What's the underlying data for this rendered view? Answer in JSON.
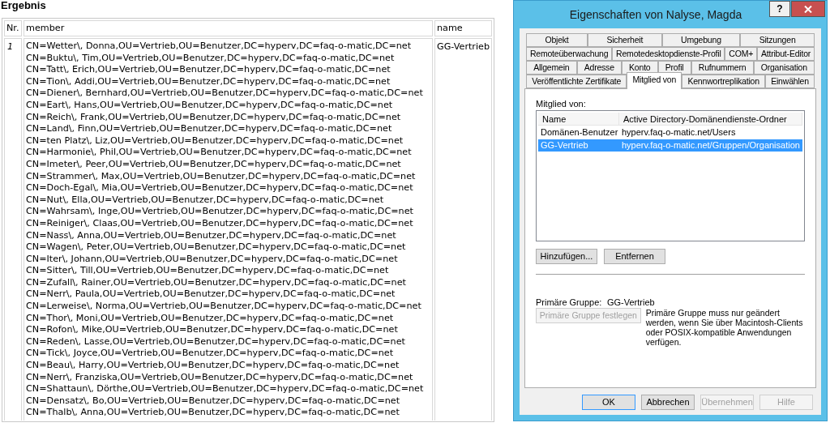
{
  "heading": "Ergebnis",
  "table": {
    "columns": [
      "Nr.",
      "member",
      "name"
    ],
    "rows": [
      {
        "nr": "1",
        "name": "GG-Vertrieb",
        "member": [
          "CN=Wetter\\, Donna,OU=Vertrieb,OU=Benutzer,DC=hyperv,DC=faq-o-matic,DC=net",
          "CN=Buktu\\, Tim,OU=Vertrieb,OU=Benutzer,DC=hyperv,DC=faq-o-matic,DC=net",
          "CN=Tatt\\, Erich,OU=Vertrieb,OU=Benutzer,DC=hyperv,DC=faq-o-matic,DC=net",
          "CN=Tion\\, Addi,OU=Vertrieb,OU=Benutzer,DC=hyperv,DC=faq-o-matic,DC=net",
          "CN=Diener\\, Bernhard,OU=Vertrieb,OU=Benutzer,DC=hyperv,DC=faq-o-matic,DC=net",
          "CN=Eart\\, Hans,OU=Vertrieb,OU=Benutzer,DC=hyperv,DC=faq-o-matic,DC=net",
          "CN=Reich\\, Frank,OU=Vertrieb,OU=Benutzer,DC=hyperv,DC=faq-o-matic,DC=net",
          "CN=Land\\, Finn,OU=Vertrieb,OU=Benutzer,DC=hyperv,DC=faq-o-matic,DC=net",
          "CN=ten Platz\\, Liz,OU=Vertrieb,OU=Benutzer,DC=hyperv,DC=faq-o-matic,DC=net",
          "CN=Harmonie\\, Phil,OU=Vertrieb,OU=Benutzer,DC=hyperv,DC=faq-o-matic,DC=net",
          "CN=Imeter\\, Peer,OU=Vertrieb,OU=Benutzer,DC=hyperv,DC=faq-o-matic,DC=net",
          "CN=Strammer\\, Max,OU=Vertrieb,OU=Benutzer,DC=hyperv,DC=faq-o-matic,DC=net",
          "CN=Doch-Egal\\, Mia,OU=Vertrieb,OU=Benutzer,DC=hyperv,DC=faq-o-matic,DC=net",
          "CN=Nut\\, Ella,OU=Vertrieb,OU=Benutzer,DC=hyperv,DC=faq-o-matic,DC=net",
          "CN=Wahrsam\\, Inge,OU=Vertrieb,OU=Benutzer,DC=hyperv,DC=faq-o-matic,DC=net",
          "CN=Reiniger\\, Claas,OU=Vertrieb,OU=Benutzer,DC=hyperv,DC=faq-o-matic,DC=net",
          "CN=Nass\\, Anna,OU=Vertrieb,OU=Benutzer,DC=hyperv,DC=faq-o-matic,DC=net",
          "CN=Wagen\\, Peter,OU=Vertrieb,OU=Benutzer,DC=hyperv,DC=faq-o-matic,DC=net",
          "CN=Iter\\, Johann,OU=Vertrieb,OU=Benutzer,DC=hyperv,DC=faq-o-matic,DC=net",
          "CN=Sitter\\, Till,OU=Vertrieb,OU=Benutzer,DC=hyperv,DC=faq-o-matic,DC=net",
          "CN=Zufall\\, Rainer,OU=Vertrieb,OU=Benutzer,DC=hyperv,DC=faq-o-matic,DC=net",
          "CN=Nerr\\, Paula,OU=Vertrieb,OU=Benutzer,DC=hyperv,DC=faq-o-matic,DC=net",
          "CN=Lerweise\\, Norma,OU=Vertrieb,OU=Benutzer,DC=hyperv,DC=faq-o-matic,DC=net",
          "CN=Thor\\, Moni,OU=Vertrieb,OU=Benutzer,DC=hyperv,DC=faq-o-matic,DC=net",
          "CN=Rofon\\, Mike,OU=Vertrieb,OU=Benutzer,DC=hyperv,DC=faq-o-matic,DC=net",
          "CN=Reden\\, Lasse,OU=Vertrieb,OU=Benutzer,DC=hyperv,DC=faq-o-matic,DC=net",
          "CN=Tick\\, Joyce,OU=Vertrieb,OU=Benutzer,DC=hyperv,DC=faq-o-matic,DC=net",
          "CN=Beau\\, Harry,OU=Vertrieb,OU=Benutzer,DC=hyperv,DC=faq-o-matic,DC=net",
          "CN=Nerr\\, Franziska,OU=Vertrieb,OU=Benutzer,DC=hyperv,DC=faq-o-matic,DC=net",
          "CN=Shattaun\\, Dörthe,OU=Vertrieb,OU=Benutzer,DC=hyperv,DC=faq-o-matic,DC=net",
          "CN=Densatz\\, Bo,OU=Vertrieb,OU=Benutzer,DC=hyperv,DC=faq-o-matic,DC=net",
          "CN=Thalb\\, Anna,OU=Vertrieb,OU=Benutzer,DC=hyperv,DC=faq-o-matic,DC=net"
        ]
      }
    ]
  },
  "dialog": {
    "title": "Eigenschaften von Nalyse, Magda",
    "help_button": "?",
    "tab_rows": [
      [
        {
          "label": "Objekt",
          "selected": false
        },
        {
          "label": "Sicherheit",
          "selected": false
        },
        {
          "label": "Umgebung",
          "selected": false
        },
        {
          "label": "Sitzungen",
          "selected": false
        }
      ],
      [
        {
          "label": "Remoteüberwachung",
          "selected": false
        },
        {
          "label": "Remotedesktopdienste-Profil",
          "selected": false
        },
        {
          "label": "COM+",
          "selected": false
        },
        {
          "label": "Attribut-Editor",
          "selected": false
        }
      ],
      [
        {
          "label": "Allgemein",
          "selected": false
        },
        {
          "label": "Adresse",
          "selected": false
        },
        {
          "label": "Konto",
          "selected": false
        },
        {
          "label": "Profil",
          "selected": false
        },
        {
          "label": "Rufnummern",
          "selected": false
        },
        {
          "label": "Organisation",
          "selected": false
        }
      ],
      [
        {
          "label": "Veröffentlichte Zertifikate",
          "selected": false
        },
        {
          "label": "Mitglied von",
          "selected": true
        },
        {
          "label": "Kennwortreplikation",
          "selected": false
        },
        {
          "label": "Einwählen",
          "selected": false
        }
      ]
    ],
    "member_label": "Mitglied von:",
    "list": {
      "columns": [
        "Name",
        "Active Directory-Domänendienste-Ordner"
      ],
      "rows": [
        {
          "name": "Domänen-Benutzer",
          "folder": "hyperv.faq-o-matic.net/Users",
          "selected": false
        },
        {
          "name": "GG-Vertrieb",
          "folder": "hyperv.faq-o-matic.net/Gruppen/Organisation",
          "selected": true
        }
      ]
    },
    "list_buttons": [
      {
        "label": "Hinzufügen..."
      },
      {
        "label": "Entfernen"
      }
    ],
    "primary_group": {
      "label": "Primäre Gruppe:",
      "value": "GG-Vertrieb",
      "button": {
        "label": "Primäre Gruppe festlegen",
        "disabled": true
      },
      "note": "Primäre Gruppe muss nur geändert werden, wenn Sie über Macintosh-Clients oder POSIX-kompatible Anwendungen verfügen."
    },
    "buttons": [
      {
        "label": "OK",
        "disabled": false,
        "default": true
      },
      {
        "label": "Abbrechen",
        "disabled": false,
        "default": false
      },
      {
        "label": "Übernehmen",
        "disabled": true,
        "default": false
      },
      {
        "label": "Hilfe",
        "disabled": true,
        "default": false
      }
    ]
  }
}
